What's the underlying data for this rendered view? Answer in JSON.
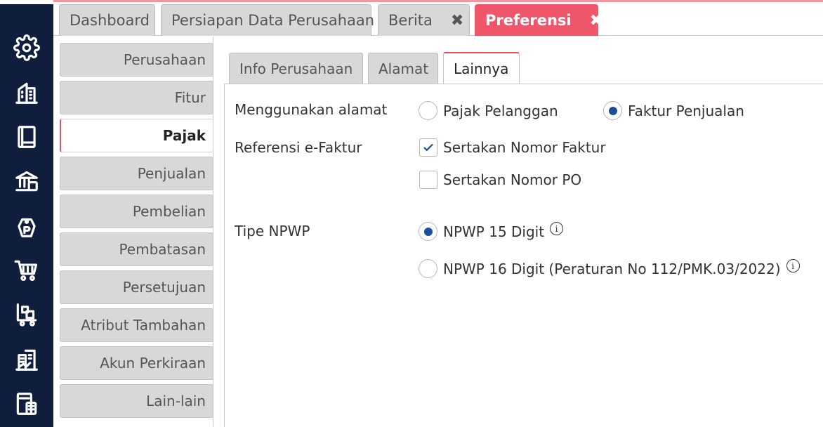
{
  "top_tabs": [
    {
      "label": "Dashboard"
    },
    {
      "label": "Persiapan Data Perusahaan"
    },
    {
      "label": "Berita",
      "close": "✖"
    },
    {
      "label": "Preferensi",
      "close": "✖"
    }
  ],
  "side_menu": [
    {
      "label": "Perusahaan"
    },
    {
      "label": "Fitur"
    },
    {
      "label": "Pajak"
    },
    {
      "label": "Penjualan"
    },
    {
      "label": "Pembelian"
    },
    {
      "label": "Pembatasan"
    },
    {
      "label": "Persetujuan"
    },
    {
      "label": "Atribut Tambahan"
    },
    {
      "label": "Akun Perkiraan"
    },
    {
      "label": "Lain-lain"
    }
  ],
  "sub_tabs": [
    {
      "label": "Info Perusahaan"
    },
    {
      "label": "Alamat"
    },
    {
      "label": "Lainnya"
    }
  ],
  "form": {
    "alamat": {
      "label": "Menggunakan alamat",
      "options": [
        {
          "label": "Pajak Pelanggan",
          "selected": false
        },
        {
          "label": "Faktur Penjualan",
          "selected": true
        }
      ]
    },
    "efaktur": {
      "label": "Referensi e-Faktur",
      "options": [
        {
          "label": "Sertakan Nomor Faktur",
          "checked": true
        },
        {
          "label": "Sertakan Nomor PO",
          "checked": false
        }
      ]
    },
    "npwp": {
      "label": "Tipe NPWP",
      "options": [
        {
          "label": "NPWP 15 Digit",
          "selected": true
        },
        {
          "label": "NPWP 16 Digit (Peraturan No 112/PMK.03/2022)",
          "selected": false
        }
      ],
      "info_glyph": "i"
    }
  },
  "colors": {
    "sidebar_bg": "#0f1e3d",
    "accent": "#f0566a",
    "radio_dot": "#1a4f9c"
  },
  "icons": [
    "gear-icon",
    "building-icon",
    "book-icon",
    "bank-icon",
    "price-tag-icon",
    "cart-icon",
    "warehouse-cart-icon",
    "company-report-icon",
    "tax-calculator-icon"
  ]
}
